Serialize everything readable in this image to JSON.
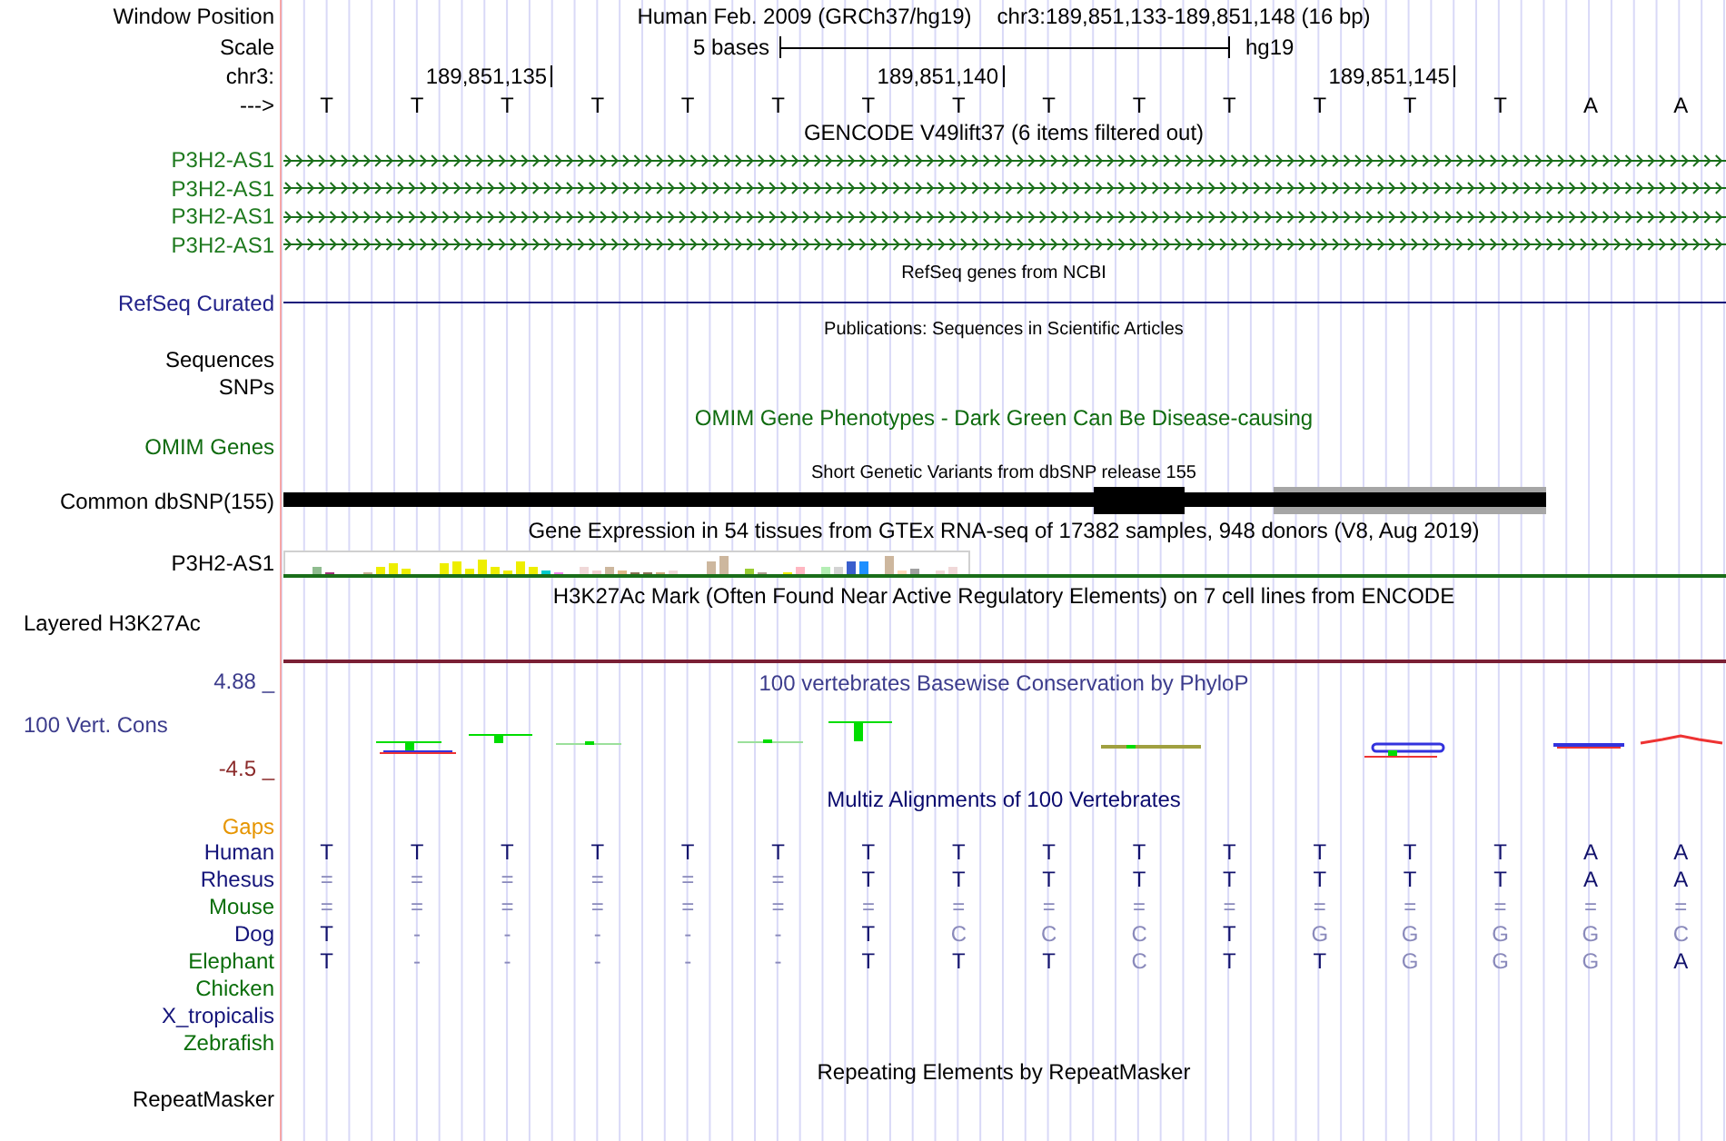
{
  "header": {
    "label": "Window Position",
    "assembly": "Human Feb. 2009 (GRCh37/hg19)",
    "position": "chr3:189,851,133-189,851,148 (16 bp)"
  },
  "scale": {
    "label": "Scale",
    "length": "5 bases",
    "assembly": "hg19"
  },
  "ruler": {
    "label": "chr3:",
    "ticks": [
      "189,851,135",
      "189,851,140",
      "189,851,145"
    ]
  },
  "sequence": {
    "label": "--->",
    "bases": [
      "T",
      "T",
      "T",
      "T",
      "T",
      "T",
      "T",
      "T",
      "T",
      "T",
      "T",
      "T",
      "T",
      "T",
      "A",
      "A"
    ]
  },
  "tracks": [
    {
      "kind": "genes",
      "title": "GENCODE V49lift37 (6 items filtered out)",
      "items": [
        {
          "label": "P3H2-AS1"
        },
        {
          "label": "P3H2-AS1"
        },
        {
          "label": "P3H2-AS1"
        },
        {
          "label": "P3H2-AS1"
        }
      ]
    },
    {
      "kind": "refseq",
      "title": "RefSeq genes from NCBI",
      "label": "RefSeq Curated"
    },
    {
      "kind": "publications",
      "title": "Publications: Sequences in Scientific Articles",
      "labels": [
        "Sequences",
        "SNPs"
      ]
    },
    {
      "kind": "omim",
      "title": "OMIM Gene Phenotypes - Dark Green Can Be Disease-causing",
      "label": "OMIM Genes"
    },
    {
      "kind": "snp",
      "title": "Short Genetic Variants from dbSNP release 155",
      "label": "Common dbSNP(155)"
    },
    {
      "kind": "gtex",
      "title": "Gene Expression in 54 tissues from GTEx RNA-seq of 17382 samples, 948 donors (V8, Aug 2019)",
      "label": "P3H2-AS1"
    },
    {
      "kind": "h3k27ac",
      "title": "H3K27Ac Mark (Often Found Near Active Regulatory Elements) on 7 cell lines from ENCODE",
      "label": "Layered H3K27Ac"
    },
    {
      "kind": "phylop",
      "title": "100 vertebrates Basewise Conservation by PhyloP",
      "label": "100 Vert. Cons",
      "axis_max": "4.88 _",
      "axis_min": "-4.5 _"
    },
    {
      "kind": "multiz",
      "title": "Multiz Alignments of 100 Vertebrates",
      "gaps_label": "Gaps",
      "species": [
        {
          "name": "Human",
          "color": "#14147a",
          "bases": [
            {
              "text": "T",
              "dimmed": false
            },
            {
              "text": "T",
              "dimmed": false
            },
            {
              "text": "T",
              "dimmed": false
            },
            {
              "text": "T",
              "dimmed": false
            },
            {
              "text": "T",
              "dimmed": false
            },
            {
              "text": "T",
              "dimmed": false
            },
            {
              "text": "T",
              "dimmed": false
            },
            {
              "text": "T",
              "dimmed": false
            },
            {
              "text": "T",
              "dimmed": false
            },
            {
              "text": "T",
              "dimmed": false
            },
            {
              "text": "T",
              "dimmed": false
            },
            {
              "text": "T",
              "dimmed": false
            },
            {
              "text": "T",
              "dimmed": false
            },
            {
              "text": "T",
              "dimmed": false
            },
            {
              "text": "A",
              "dimmed": false
            },
            {
              "text": "A",
              "dimmed": false
            }
          ]
        },
        {
          "name": "Rhesus",
          "color": "#14147a",
          "bases": [
            {
              "text": "=",
              "dimmed": true
            },
            {
              "text": "=",
              "dimmed": true
            },
            {
              "text": "=",
              "dimmed": true
            },
            {
              "text": "=",
              "dimmed": true
            },
            {
              "text": "=",
              "dimmed": true
            },
            {
              "text": "=",
              "dimmed": true
            },
            {
              "text": "T",
              "dimmed": false
            },
            {
              "text": "T",
              "dimmed": false
            },
            {
              "text": "T",
              "dimmed": false
            },
            {
              "text": "T",
              "dimmed": false
            },
            {
              "text": "T",
              "dimmed": false
            },
            {
              "text": "T",
              "dimmed": false
            },
            {
              "text": "T",
              "dimmed": false
            },
            {
              "text": "T",
              "dimmed": false
            },
            {
              "text": "A",
              "dimmed": false
            },
            {
              "text": "A",
              "dimmed": false
            }
          ]
        },
        {
          "name": "Mouse",
          "color": "#0a6e0a",
          "bases": [
            {
              "text": "=",
              "dimmed": true
            },
            {
              "text": "=",
              "dimmed": true
            },
            {
              "text": "=",
              "dimmed": true
            },
            {
              "text": "=",
              "dimmed": true
            },
            {
              "text": "=",
              "dimmed": true
            },
            {
              "text": "=",
              "dimmed": true
            },
            {
              "text": "=",
              "dimmed": true
            },
            {
              "text": "=",
              "dimmed": true
            },
            {
              "text": "=",
              "dimmed": true
            },
            {
              "text": "=",
              "dimmed": true
            },
            {
              "text": "=",
              "dimmed": true
            },
            {
              "text": "=",
              "dimmed": true
            },
            {
              "text": "=",
              "dimmed": true
            },
            {
              "text": "=",
              "dimmed": true
            },
            {
              "text": "=",
              "dimmed": true
            },
            {
              "text": "=",
              "dimmed": true
            }
          ]
        },
        {
          "name": "Dog",
          "color": "#14147a",
          "bases": [
            {
              "text": "T",
              "dimmed": false
            },
            {
              "text": "-",
              "dimmed": true
            },
            {
              "text": "-",
              "dimmed": true
            },
            {
              "text": "-",
              "dimmed": true
            },
            {
              "text": "-",
              "dimmed": true
            },
            {
              "text": "-",
              "dimmed": true
            },
            {
              "text": "T",
              "dimmed": false
            },
            {
              "text": "C",
              "dimmed": true
            },
            {
              "text": "C",
              "dimmed": true
            },
            {
              "text": "C",
              "dimmed": true
            },
            {
              "text": "T",
              "dimmed": false
            },
            {
              "text": "G",
              "dimmed": true
            },
            {
              "text": "G",
              "dimmed": true
            },
            {
              "text": "G",
              "dimmed": true
            },
            {
              "text": "G",
              "dimmed": true
            },
            {
              "text": "C",
              "dimmed": true
            }
          ]
        },
        {
          "name": "Elephant",
          "color": "#0a6e0a",
          "bases": [
            {
              "text": "T",
              "dimmed": false
            },
            {
              "text": "-",
              "dimmed": true
            },
            {
              "text": "-",
              "dimmed": true
            },
            {
              "text": "-",
              "dimmed": true
            },
            {
              "text": "-",
              "dimmed": true
            },
            {
              "text": "-",
              "dimmed": true
            },
            {
              "text": "T",
              "dimmed": false
            },
            {
              "text": "T",
              "dimmed": false
            },
            {
              "text": "T",
              "dimmed": false
            },
            {
              "text": "C",
              "dimmed": true
            },
            {
              "text": "T",
              "dimmed": false
            },
            {
              "text": "T",
              "dimmed": false
            },
            {
              "text": "G",
              "dimmed": true
            },
            {
              "text": "G",
              "dimmed": true
            },
            {
              "text": "G",
              "dimmed": true
            },
            {
              "text": "A",
              "dimmed": false
            }
          ]
        },
        {
          "name": "Chicken",
          "color": "#0a6e0a"
        },
        {
          "name": "X_tropicalis",
          "color": "#14147a"
        },
        {
          "name": "Zebrafish",
          "color": "#0a6e0a"
        }
      ]
    },
    {
      "kind": "repeats",
      "title": "Repeating Elements by RepeatMasker",
      "label": "RepeatMasker"
    }
  ]
}
